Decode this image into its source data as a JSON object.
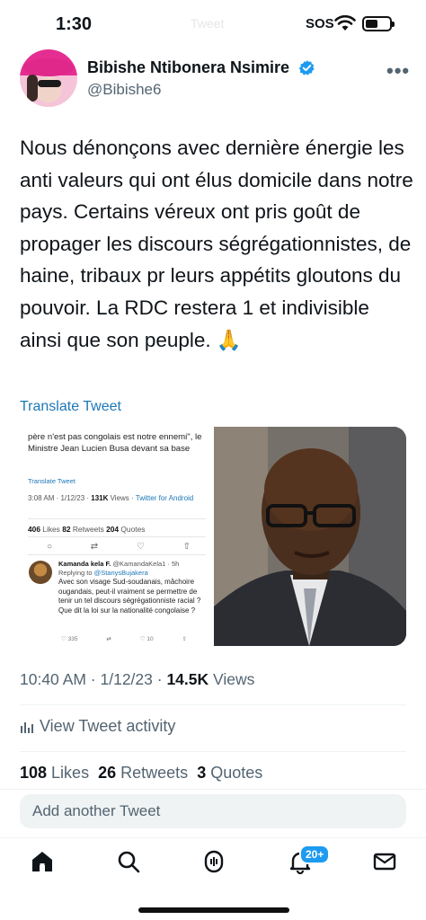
{
  "status_bar": {
    "time": "1:30",
    "ghost_title": "Tweet",
    "sos": "SOS"
  },
  "author": {
    "name": "Bibishe Ntibonera Nsimire",
    "handle": "@Bibishe6"
  },
  "tweet": {
    "text": "Nous dénonçons avec dernière énergie les anti valeurs qui ont élus domicile dans notre pays. Certains véreux ont pris goût de propager les discours ségrégationnistes, de haine, tribaux pr leurs appétits gloutons du pouvoir. La RDC restera 1 et indivisible ainsi que son peuple. 🙏",
    "translate_label": "Translate Tweet",
    "time": "10:40 AM · 1/12/23 · ",
    "views_count": "14.5K",
    "views_label": " Views",
    "activity_label": "View Tweet activity",
    "likes_count": "108",
    "likes_label": " Likes",
    "retweets_count": "26",
    "retweets_label": " Retweets",
    "quotes_count": "3",
    "quotes_label": " Quotes"
  },
  "embedded": {
    "snippet": "père n'est pas congolais est notre ennemi\", le Ministre Jean Lucien Busa devant sa base",
    "translate_label": "Translate Tweet",
    "meta_time": "3:08 AM · 1/12/23 · ",
    "meta_views": "131K",
    "meta_views_label": " Views · ",
    "meta_source": "Twitter for Android",
    "likes": "406",
    "likes_label": " Likes  ",
    "retweets": "82",
    "retweets_label": " Retweets  ",
    "quotes": "204",
    "quotes_label": " Quotes",
    "reply_name": "Kamanda kela F.",
    "reply_handle": " @KamandaKela1 · 5h",
    "replying_label": "Replying to ",
    "replying_handle": "@StanysBujakera",
    "reply_text": "Avec son visage  Sud-soudanais, mâchoire ougandais, peut-il vraiment se permettre de tenir un tel discours ségrégationniste racial ? Que dit la loi sur la nationalité congolaise ?",
    "reply_likes": "335",
    "reply_retweets": "10"
  },
  "composer": {
    "placeholder": "Add another Tweet"
  },
  "tab_bar": {
    "notifications_badge": "20+"
  },
  "colors": {
    "accent": "#1d9bf0",
    "link": "#1d77b7",
    "text": "#0f1419",
    "muted": "#536471"
  },
  "icons": [
    "verified-badge-icon",
    "more-icon",
    "wifi-icon",
    "battery-icon",
    "bar-chart-icon",
    "home-icon",
    "search-icon",
    "spaces-icon",
    "notifications-icon",
    "messages-icon",
    "reply-icon",
    "retweet-icon",
    "like-icon",
    "share-icon"
  ]
}
